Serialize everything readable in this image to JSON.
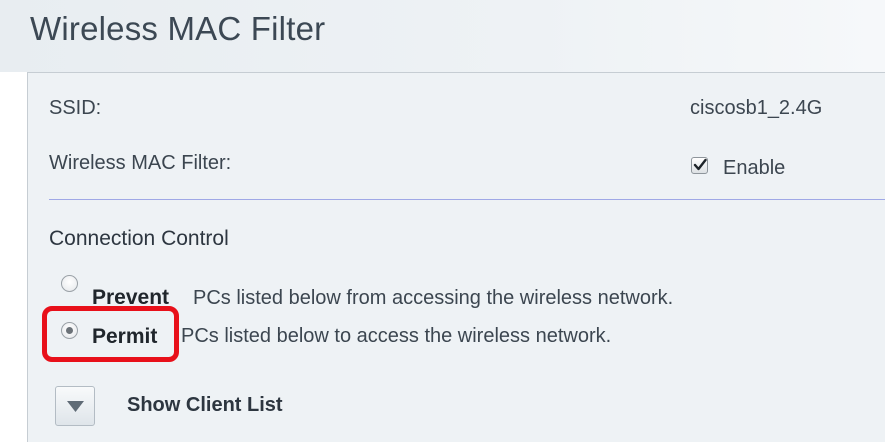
{
  "page": {
    "title": "Wireless MAC Filter"
  },
  "settings": {
    "ssid_label": "SSID:",
    "ssid_value": "ciscosb1_2.4G",
    "mac_filter_label": "Wireless MAC Filter:",
    "mac_filter_checkbox_label": "Enable",
    "mac_filter_enabled": true
  },
  "connection_control": {
    "heading": "Connection Control",
    "options": [
      {
        "label": "Prevent",
        "description": "PCs listed below from accessing the wireless network.",
        "selected": false
      },
      {
        "label": "Permit",
        "description": "PCs listed below to access the wireless network.",
        "selected": true
      }
    ]
  },
  "client_list": {
    "toggle_label": "Show Client List",
    "toggle_icon": "chevron-down-icon"
  },
  "colors": {
    "highlight": "#e8101a",
    "divider": "#9fa8e6",
    "panel_bg": "#eef2f5"
  }
}
